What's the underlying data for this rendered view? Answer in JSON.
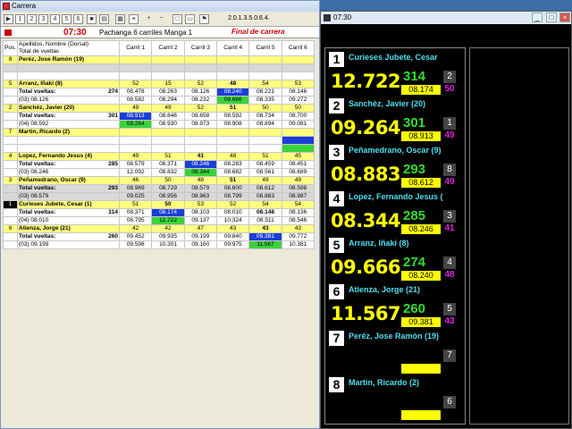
{
  "left_window": {
    "title": "Carrera",
    "toolbar_info": "2.0.1.3.5.0.6.4.",
    "clock": "07:30",
    "manga": "Pachanga 6 carriles Manga 1",
    "status": "Final de carrera",
    "headers": {
      "pos": "Pos.",
      "name": "Apellidos, Nombre (Dorsal)",
      "name2": "Total de vueltas",
      "lanes": [
        "Carril 1",
        "Carril 2",
        "Carril 3",
        "Carril 4",
        "Carril 5",
        "Carril 6"
      ]
    },
    "rows": [
      {
        "type": "yel",
        "cells": [
          "8",
          "Peréz, Jose Ramón (19)",
          "",
          "",
          "",
          "",
          "",
          ""
        ]
      },
      {
        "type": "gray",
        "cells": [
          "",
          "",
          "",
          "",
          "",
          "",
          "",
          ""
        ]
      },
      {
        "type": "white",
        "cells": [
          "",
          "",
          "",
          "",
          "",
          "",
          "",
          ""
        ]
      },
      {
        "type": "yel",
        "cells": [
          "5",
          "Arranz, Iñaki (8)",
          "52",
          "15",
          "52",
          "48",
          "54",
          "53"
        ]
      },
      {
        "type": "white",
        "cells": [
          "",
          "Total vueltas:|274",
          "08.478",
          "08.263",
          "08.126",
          "08.240",
          "08.221",
          "08.146"
        ]
      },
      {
        "type": "white",
        "cells": [
          "",
          "(03) 08.126",
          "08.582",
          "08.294",
          "08.232",
          "09.666",
          "08.335",
          "09.272"
        ]
      },
      {
        "type": "yel",
        "cells": [
          "2",
          "Sanchéz, Javier (20)",
          "49",
          "49",
          "52",
          "51",
          "50",
          "50"
        ]
      },
      {
        "type": "white",
        "cells": [
          "",
          "Total vueltas:|301",
          "08.913",
          "08.846",
          "08.658",
          "08.592",
          "08.734",
          "08.700"
        ]
      },
      {
        "type": "white",
        "cells": [
          "",
          "(04) 08.592",
          "09.264",
          "08.930",
          "08.973",
          "08.908",
          "08.894",
          "09.081"
        ]
      },
      {
        "type": "yel",
        "cells": [
          "7",
          "Martin, Ricardo (2)",
          "",
          "",
          "",
          "",
          "",
          ""
        ]
      },
      {
        "type": "white",
        "cells": [
          "",
          "",
          "",
          "",
          "",
          "",
          "",
          ""
        ]
      },
      {
        "type": "white",
        "cells": [
          "",
          "",
          "",
          "",
          "",
          "",
          "",
          ""
        ]
      },
      {
        "type": "yel",
        "cells": [
          "4",
          "Lopez, Fernando Jesus (4)",
          "49",
          "51",
          "41",
          "48",
          "51",
          "45"
        ]
      },
      {
        "type": "white",
        "cells": [
          "",
          "Total vueltas:|285",
          "08.579",
          "08.371",
          "08.246",
          "08.283",
          "08.459",
          "08.451"
        ]
      },
      {
        "type": "white",
        "cells": [
          "",
          "(03) 08.246",
          "12.092",
          "08.832",
          "08.344",
          "08.682",
          "08.561",
          "08.689"
        ]
      },
      {
        "type": "yel",
        "cells": [
          "3",
          "Peñamedrano, Oscar (9)",
          "46",
          "50",
          "48",
          "51",
          "49",
          "49"
        ]
      },
      {
        "type": "gray",
        "cells": [
          "",
          "Total vueltas:|293",
          "08.969",
          "08.729",
          "08.579",
          "08.600",
          "08.612",
          "08.598"
        ]
      },
      {
        "type": "gray",
        "cells": [
          "",
          "(03) 08.579",
          "09.025",
          "08.956",
          "08.963",
          "08.799",
          "08.883",
          "08.987"
        ]
      },
      {
        "type": "yel",
        "cells": [
          "1",
          "Curieses Jubete, Cesar (1)",
          "51",
          "50",
          "53",
          "52",
          "54",
          "54"
        ]
      },
      {
        "type": "white",
        "cells": [
          "",
          "Total vueltas:|314",
          "08.371",
          "08.174",
          "08.103",
          "08.010",
          "08.148",
          "08.136"
        ]
      },
      {
        "type": "white",
        "cells": [
          "",
          "(04) 08.010",
          "08.795",
          "12.722",
          "09.137",
          "10.324",
          "08.511",
          "08.546"
        ]
      },
      {
        "type": "yel",
        "cells": [
          "6",
          "Atienza, Jorge (21)",
          "42",
          "42",
          "47",
          "43",
          "43",
          "43"
        ]
      },
      {
        "type": "white",
        "cells": [
          "",
          "Total vueltas:|260",
          "09.452",
          "09.935",
          "09.199",
          "09.840",
          "09.381",
          "09.772"
        ]
      },
      {
        "type": "white",
        "cells": [
          "",
          "(03) 09.199",
          "09.598",
          "10.301",
          "09.160",
          "09.975",
          "11.567",
          "10.381"
        ]
      }
    ],
    "highlights": {
      "r4c5": "blue",
      "r5c5": "green",
      "r7c2": "blue",
      "r8c2": "green",
      "r10c7": "blue",
      "r11c7": "green",
      "r13c4": "blue",
      "r14c4": "green",
      "r18c0": "dark",
      "r19c3": "blue",
      "r20c3": "green",
      "r22c6": "blue",
      "r23c6": "green",
      "r12c4": "bold",
      "r18c3": "bold",
      "r19c6": "bold",
      "r21c6": "bold",
      "r6c5": "bold",
      "r3c5": "bold",
      "r15c5": "bold"
    }
  },
  "right_window": {
    "clock": "07:30",
    "entries": [
      {
        "pos": "1",
        "name": "Curieses Jubete, Cesar",
        "time": "12.722",
        "laps": "314",
        "best": "08.174",
        "lane": "2",
        "gap": "50"
      },
      {
        "pos": "2",
        "name": "Sanchéz, Javier (20)",
        "time": "09.264",
        "laps": "301",
        "best": "08.913",
        "lane": "1",
        "gap": "49"
      },
      {
        "pos": "3",
        "name": "Peñamedrano, Oscar (9)",
        "time": "08.883",
        "laps": "293",
        "best": "08.612",
        "lane": "8",
        "gap": "49"
      },
      {
        "pos": "4",
        "name": "Lopez, Fernando Jesus (",
        "time": "08.344",
        "laps": "285",
        "best": "08.246",
        "lane": "3",
        "gap": "41"
      },
      {
        "pos": "5",
        "name": "Arranz, Iñaki (8)",
        "time": "09.666",
        "laps": "274",
        "best": "08.240",
        "lane": "4",
        "gap": "48"
      },
      {
        "pos": "6",
        "name": "Atienza, Jorge (21)",
        "time": "11.567",
        "laps": "260",
        "best": "09.381",
        "lane": "5",
        "gap": "43"
      },
      {
        "pos": "7",
        "name": "Peréz, Jose Ramón (19)",
        "time": "",
        "laps": "",
        "best": "",
        "lane": "7",
        "gap": ""
      },
      {
        "pos": "8",
        "name": "Martin, Ricardo (2)",
        "time": "",
        "laps": "",
        "best": "",
        "lane": "6",
        "gap": ""
      }
    ]
  },
  "colors": {
    "yellow_row": "#ffff80",
    "highlight_blue": "#1a3fd6",
    "highlight_green": "#3cd23c",
    "driver_cyan": "#4fe0f0",
    "time_yellow": "#ffff00"
  }
}
